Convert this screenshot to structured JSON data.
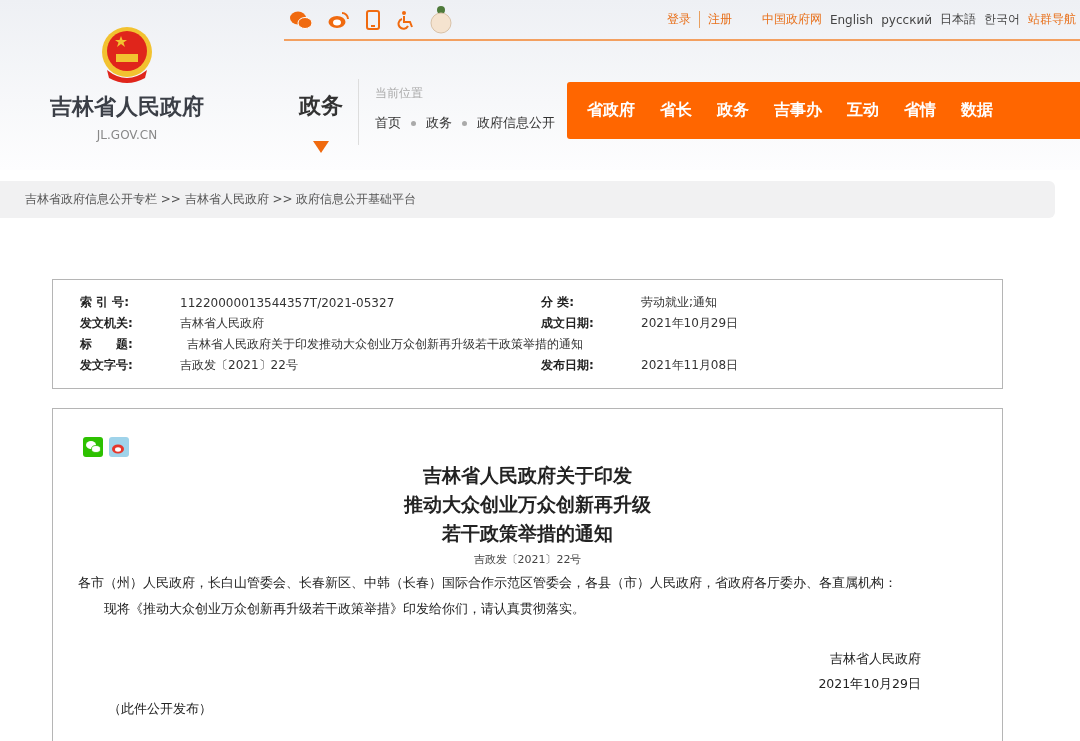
{
  "site": {
    "name": "吉林省人民政府",
    "domain": "JL.GOV.CN"
  },
  "top_links": [
    {
      "label": "登录",
      "kind": "accent"
    },
    {
      "label": "注册",
      "kind": "accent"
    },
    {
      "label": "中国政府网",
      "kind": "accent"
    },
    {
      "label": "English",
      "kind": "plain"
    },
    {
      "label": "русский",
      "kind": "plain"
    },
    {
      "label": "日本語",
      "kind": "plain"
    },
    {
      "label": "한국어",
      "kind": "plain"
    },
    {
      "label": "站群导航",
      "kind": "accent"
    }
  ],
  "section": {
    "title": "政务",
    "location_label": "当前位置",
    "location": [
      "首页",
      "政务",
      "政府信息公开"
    ]
  },
  "nav": [
    "省政府",
    "省长",
    "政务",
    "吉事办",
    "互动",
    "省情",
    "数据"
  ],
  "breadcrumb": "吉林省政府信息公开专栏 >> 吉林省人民政府 >> 政府信息公开基础平台",
  "meta": [
    [
      {
        "label": "索 引 号:",
        "value": "11220000013544357T/2021-05327"
      },
      {
        "label": "分 类:",
        "value": "劳动就业;通知"
      }
    ],
    [
      {
        "label": "发文机关:",
        "value": "吉林省人民政府"
      },
      {
        "label": "成文日期:",
        "value": "2021年10月29日"
      }
    ],
    [
      {
        "label": "标　　题:",
        "value": "吉林省人民政府关于印发推动大众创业万众创新再升级若干政策举措的通知"
      }
    ],
    [
      {
        "label": "发文字号:",
        "value": "吉政发〔2021〕22号"
      },
      {
        "label": "发布日期:",
        "value": "2021年11月08日"
      }
    ]
  ],
  "document": {
    "title": [
      "吉林省人民政府关于印发",
      "推动大众创业万众创新再升级",
      "若干政策举措的通知"
    ],
    "number": "吉政发〔2021〕22号",
    "addressee": "各市（州）人民政府，长白山管委会、长春新区、中韩（长春）国际合作示范区管委会，各县（市）人民政府，省政府各厅委办、各直属机构：",
    "body": "现将《推动大众创业万众创新再升级若干政策举措》印发给你们，请认真贯彻落实。",
    "signature": "吉林省人民政府",
    "date": "2021年10月29日",
    "note": "（此件公开发布）"
  }
}
